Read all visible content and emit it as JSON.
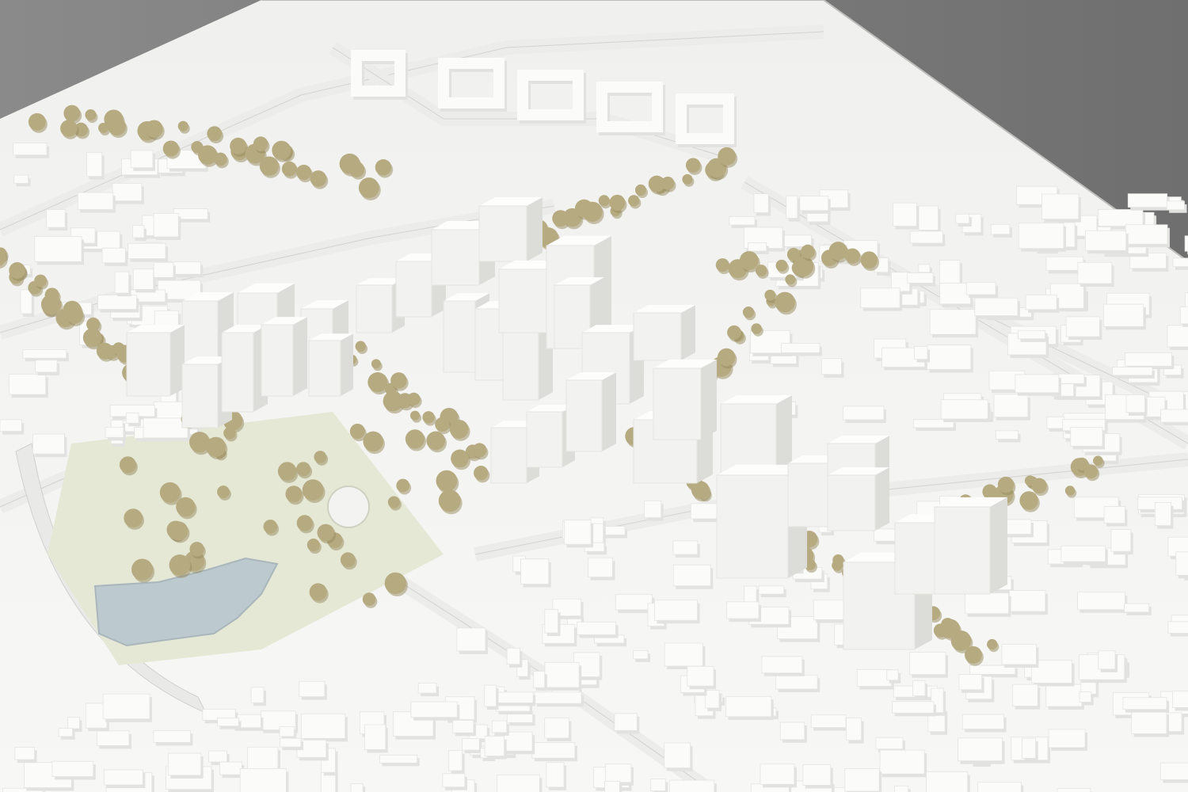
{
  "scene": {
    "subject": "architectural-urban-model",
    "colors": {
      "background": "#7d7d7d",
      "base": "#f4f4f2",
      "base_shadow": "#d8d8d6",
      "block": "#fbfbfa",
      "block_side": "#e2e2e0",
      "tower_front": "#f2f2f0",
      "tower_side": "#dcdcd9",
      "tower_top": "#fdfdfc",
      "tree": "#b6aa80",
      "tree_dark": "#958a5e",
      "park": "#e6e8d6",
      "water": "#bcc9cf",
      "road": "#ececea"
    }
  }
}
